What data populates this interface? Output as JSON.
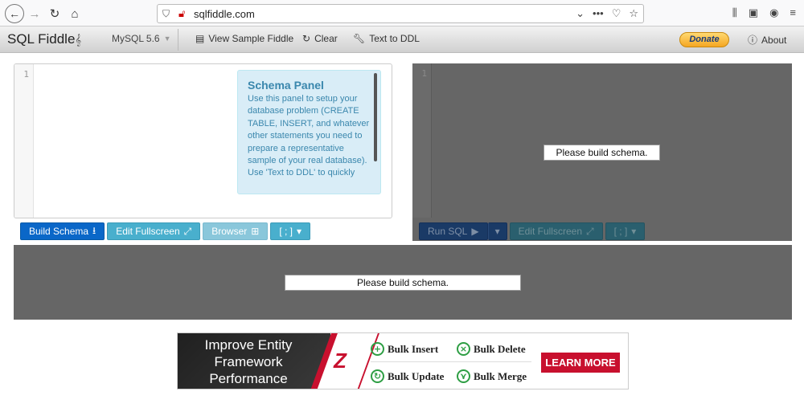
{
  "browser": {
    "url": "sqlfiddle.com"
  },
  "navbar": {
    "brand": "SQL Fiddle",
    "db_version": "MySQL 5.6",
    "view_sample": "View Sample Fiddle",
    "clear": "Clear",
    "text_to_ddl": "Text to DDL",
    "donate": "Donate",
    "about": "About"
  },
  "schema": {
    "line_number": "1",
    "help_title": "Schema Panel",
    "help_body": "Use this panel to setup your database problem (CREATE TABLE, INSERT, and whatever other statements you need to prepare a representative sample of your real database). Use 'Text to DDL' to quickly",
    "build_schema": "Build Schema",
    "edit_fullscreen": "Edit Fullscreen",
    "browser": "Browser",
    "separator": "[ ; ]"
  },
  "query": {
    "line_number": "1",
    "message": "Please build schema.",
    "run_sql": "Run SQL",
    "edit_fullscreen": "Edit Fullscreen",
    "separator": "[ ; ]"
  },
  "results": {
    "message": "Please build schema."
  },
  "ad": {
    "headline": "Improve Entity Framework Performance",
    "features": [
      "Bulk Insert",
      "Bulk Delete",
      "Bulk Update",
      "Bulk Merge"
    ],
    "cta": "LEARN MORE"
  },
  "icons": {
    "back": "arrow-left-icon",
    "forward": "arrow-right-icon",
    "reload": "reload-icon",
    "home": "home-icon",
    "library": "library-icon",
    "sidebar": "sidebar-icon",
    "account": "account-icon",
    "menu": "hamburger-menu-icon"
  }
}
